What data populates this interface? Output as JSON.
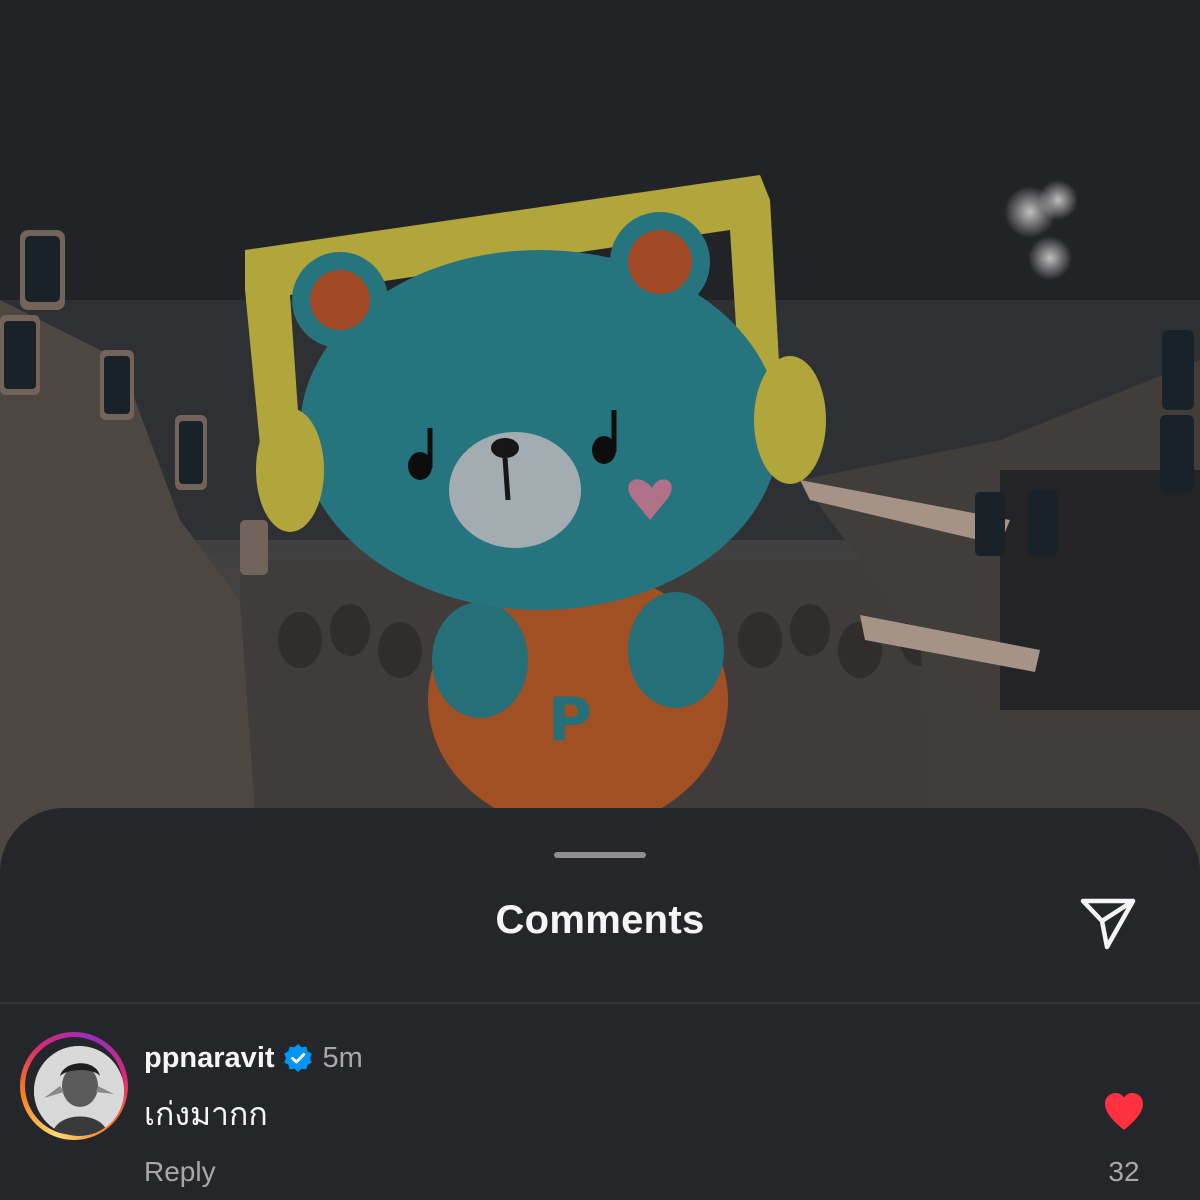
{
  "sheet": {
    "title": "Comments"
  },
  "comment": {
    "username": "ppnaravit",
    "verified": true,
    "timestamp": "5m",
    "text": "เก่งมากก",
    "reply_label": "Reply",
    "liked": true,
    "like_count": "32"
  },
  "colors": {
    "sheet_background": "#25262a",
    "like_red": "#ff3040",
    "verified_blue": "#0095f6",
    "mascot_head": "#2f8f9a",
    "mascot_headphones": "#e0d24a",
    "mascot_shirt": "#d86a26"
  },
  "icons": {
    "share": "paper-plane-icon",
    "verified": "verified-badge-icon",
    "like": "heart-filled-icon"
  }
}
